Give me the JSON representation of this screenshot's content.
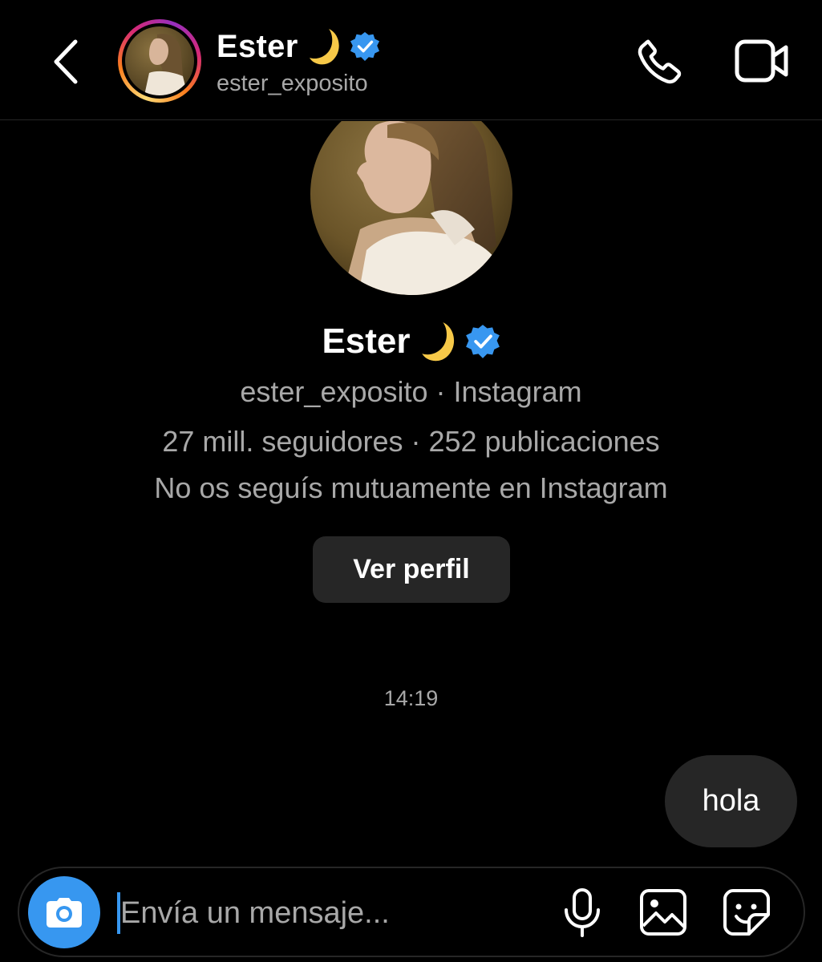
{
  "header": {
    "name": "Ester",
    "username": "ester_exposito",
    "icons": [
      "back-icon",
      "moon-emoji-icon",
      "verified-icon",
      "phone-icon",
      "video-camera-icon"
    ]
  },
  "profile_card": {
    "name": "Ester",
    "username_line": "ester_exposito · Instagram",
    "stats_line": "27 mill. seguidores · 252 publicaciones",
    "mutual_line": "No os seguís mutuamente en Instagram",
    "view_profile_label": "Ver perfil"
  },
  "messages": [
    {
      "timestamp": "14:19",
      "text": "hola",
      "sender": "me"
    }
  ],
  "composer": {
    "placeholder": "Envía un mensaje...",
    "value": "",
    "icons": [
      "camera-icon",
      "microphone-icon",
      "gallery-icon",
      "sticker-icon"
    ]
  },
  "colors": {
    "background": "#000000",
    "secondary_text": "#a8a8a8",
    "bubble": "#262626",
    "accent_blue": "#3797f0",
    "verified_blue": "#3897f0"
  }
}
